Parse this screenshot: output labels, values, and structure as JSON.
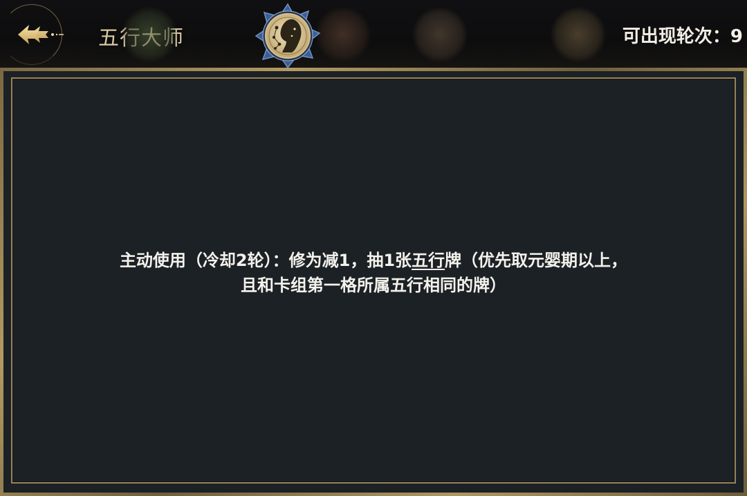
{
  "header": {
    "title": "五行大师",
    "rounds_label": "可出现轮次：",
    "rounds_value": "9"
  },
  "nodes": [
    {
      "icon": "constellation-medallion-icon",
      "state": "selected"
    },
    {
      "icon": "dim-orb-icon",
      "state": "locked"
    },
    {
      "icon": "dim-orb-icon",
      "state": "locked"
    },
    {
      "icon": "dim-orb-icon",
      "state": "locked"
    }
  ],
  "description": {
    "part1": "主动使用（冷却2轮）：修为减1，抽1张",
    "keyword": "五行",
    "part2": "牌（优先取元婴期以上，",
    "line2": "且和卡组第一格所属五行相同的牌）"
  },
  "colors": {
    "gold": "#c9a66a",
    "panel_bg": "#1b2125",
    "text": "#f4f2ec"
  }
}
